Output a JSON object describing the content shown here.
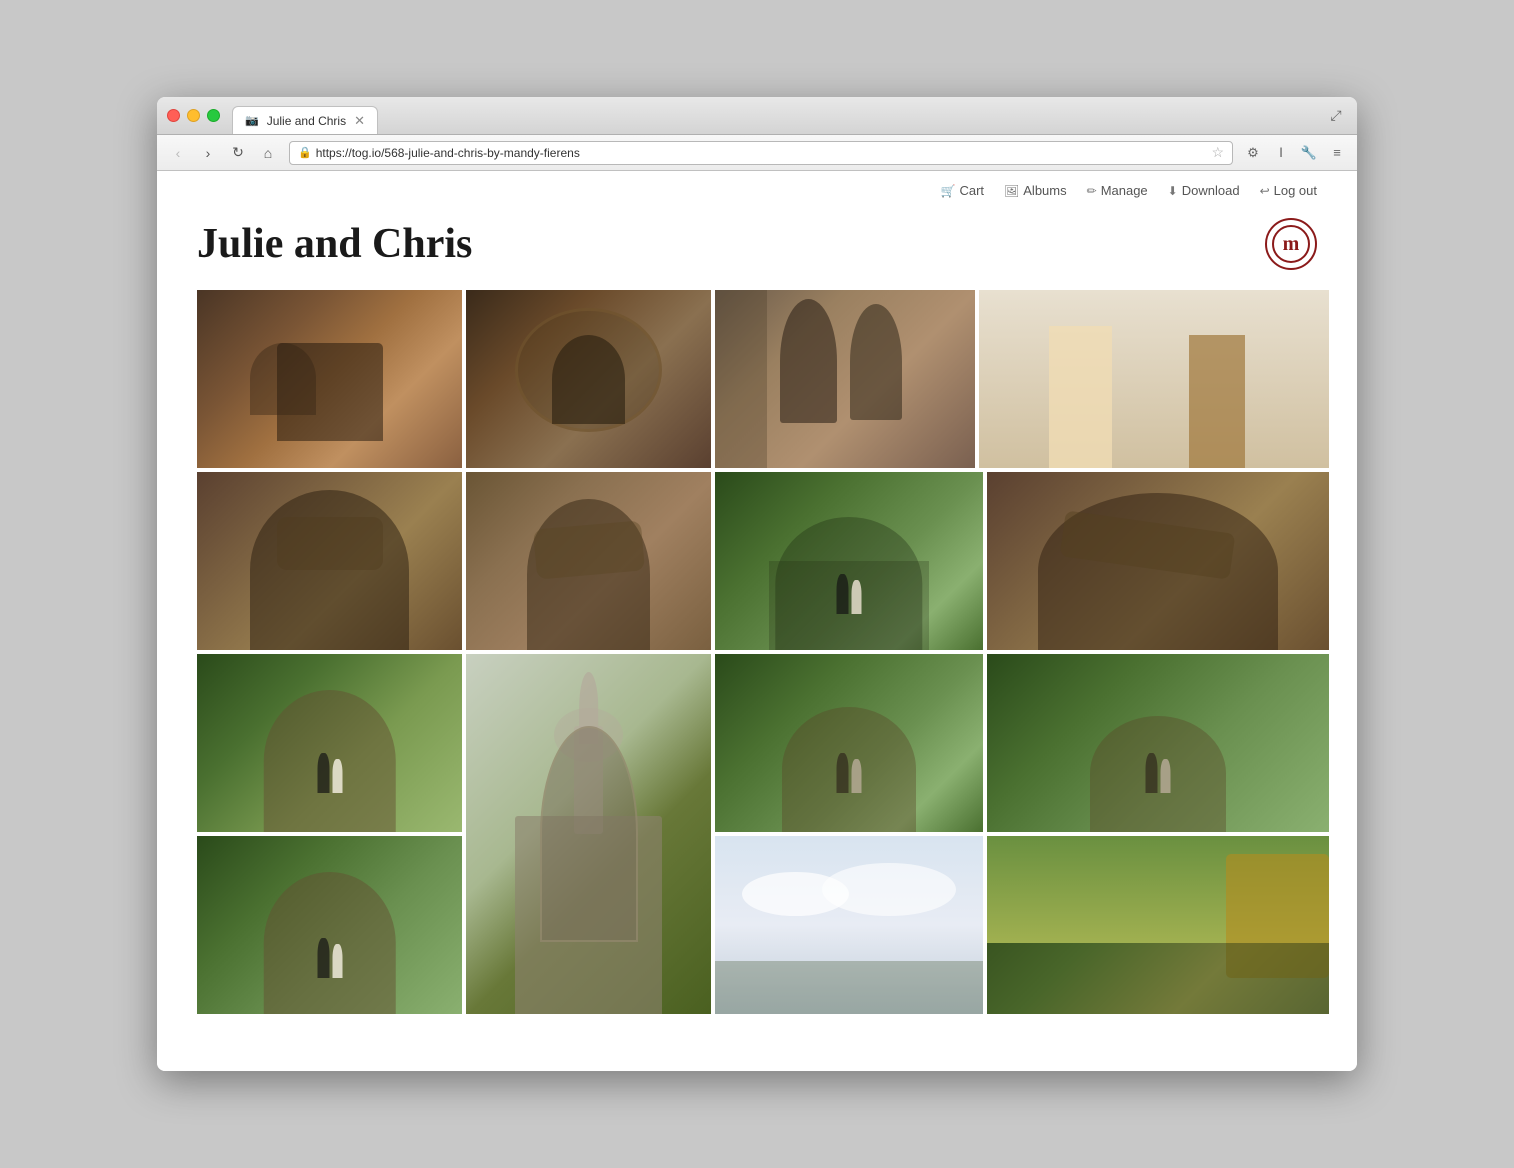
{
  "browser": {
    "tab_title": "Julie and Chris",
    "url": "https://tog.io/568-julie-and-chris-by-mandy-fierens",
    "protocol": "https",
    "favicon": "📷"
  },
  "site_nav": {
    "cart_label": "Cart",
    "albums_label": "Albums",
    "manage_label": "Manage",
    "download_label": "Download",
    "logout_label": "Log out"
  },
  "page": {
    "title": "Julie and Chris",
    "logo_initial": "m"
  },
  "photos": [
    {
      "id": 1,
      "row": 1,
      "description": "couple sitting indoors"
    },
    {
      "id": 2,
      "row": 1,
      "description": "woman in mirror reflection"
    },
    {
      "id": 3,
      "row": 1,
      "description": "couple standing portrait"
    },
    {
      "id": 4,
      "row": 1,
      "description": "couple lower body indoors"
    },
    {
      "id": 5,
      "row": 2,
      "description": "woman holding cat"
    },
    {
      "id": 6,
      "row": 2,
      "description": "woman smiling with cat"
    },
    {
      "id": 7,
      "row": 2,
      "description": "couple at arch outdoors"
    },
    {
      "id": 8,
      "row": 2,
      "description": "couple with cat side view"
    },
    {
      "id": 9,
      "row": 3,
      "description": "couple at monument"
    },
    {
      "id": 10,
      "row": 3,
      "description": "angel statue tall"
    },
    {
      "id": 11,
      "row": 3,
      "description": "couple at arch close"
    },
    {
      "id": 12,
      "row": 3,
      "description": "couple walking at monument"
    },
    {
      "id": 13,
      "row": 4,
      "description": "couple holding hands"
    },
    {
      "id": 14,
      "row": 4,
      "description": "cloudy sky"
    },
    {
      "id": 15,
      "row": 4,
      "description": "autumn trees"
    }
  ]
}
